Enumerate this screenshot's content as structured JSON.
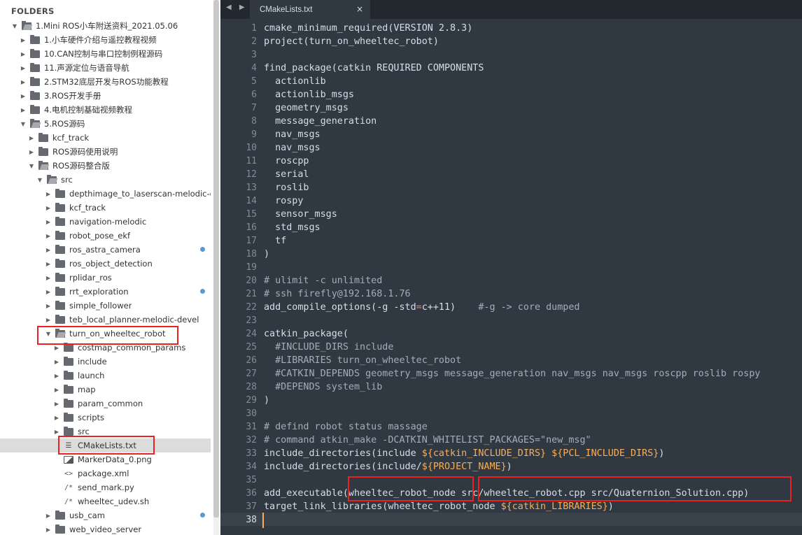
{
  "sidebar": {
    "title": "FOLDERS",
    "items": [
      {
        "label": "1.Mini ROS小车附送资料_2021.05.06",
        "depth": 0,
        "chevron": "▼",
        "icon": "folder-open-icon",
        "dot": false,
        "selected": false
      },
      {
        "label": "1.小车硬件介绍与遥控教程视频",
        "depth": 1,
        "chevron": "▶",
        "icon": "folder-icon",
        "dot": false,
        "selected": false
      },
      {
        "label": "10.CAN控制与串口控制例程源码",
        "depth": 1,
        "chevron": "▶",
        "icon": "folder-icon",
        "dot": false,
        "selected": false
      },
      {
        "label": "11.声源定位与语音导航",
        "depth": 1,
        "chevron": "▶",
        "icon": "folder-icon",
        "dot": false,
        "selected": false
      },
      {
        "label": "2.STM32底层开发与ROS功能教程",
        "depth": 1,
        "chevron": "▶",
        "icon": "folder-icon",
        "dot": false,
        "selected": false
      },
      {
        "label": "3.ROS开发手册",
        "depth": 1,
        "chevron": "▶",
        "icon": "folder-icon",
        "dot": false,
        "selected": false
      },
      {
        "label": "4.电机控制基础视频教程",
        "depth": 1,
        "chevron": "▶",
        "icon": "folder-icon",
        "dot": false,
        "selected": false
      },
      {
        "label": "5.ROS源码",
        "depth": 1,
        "chevron": "▼",
        "icon": "folder-open-icon",
        "dot": false,
        "selected": false
      },
      {
        "label": "kcf_track",
        "depth": 2,
        "chevron": "▶",
        "icon": "folder-icon",
        "dot": false,
        "selected": false
      },
      {
        "label": "ROS源码使用说明",
        "depth": 2,
        "chevron": "▶",
        "icon": "folder-icon",
        "dot": false,
        "selected": false
      },
      {
        "label": "ROS源码整合版",
        "depth": 2,
        "chevron": "▼",
        "icon": "folder-open-icon",
        "dot": false,
        "selected": false
      },
      {
        "label": "src",
        "depth": 3,
        "chevron": "▼",
        "icon": "folder-open-icon",
        "dot": false,
        "selected": false
      },
      {
        "label": "depthimage_to_laserscan-melodic-devel",
        "depth": 4,
        "chevron": "▶",
        "icon": "folder-icon",
        "dot": false,
        "selected": false
      },
      {
        "label": "kcf_track",
        "depth": 4,
        "chevron": "▶",
        "icon": "folder-icon",
        "dot": false,
        "selected": false
      },
      {
        "label": "navigation-melodic",
        "depth": 4,
        "chevron": "▶",
        "icon": "folder-icon",
        "dot": false,
        "selected": false
      },
      {
        "label": "robot_pose_ekf",
        "depth": 4,
        "chevron": "▶",
        "icon": "folder-icon",
        "dot": false,
        "selected": false
      },
      {
        "label": "ros_astra_camera",
        "depth": 4,
        "chevron": "▶",
        "icon": "folder-icon",
        "dot": true,
        "selected": false
      },
      {
        "label": "ros_object_detection",
        "depth": 4,
        "chevron": "▶",
        "icon": "folder-icon",
        "dot": false,
        "selected": false
      },
      {
        "label": "rplidar_ros",
        "depth": 4,
        "chevron": "▶",
        "icon": "folder-icon",
        "dot": false,
        "selected": false
      },
      {
        "label": "rrt_exploration",
        "depth": 4,
        "chevron": "▶",
        "icon": "folder-icon",
        "dot": true,
        "selected": false
      },
      {
        "label": "simple_follower",
        "depth": 4,
        "chevron": "▶",
        "icon": "folder-icon",
        "dot": false,
        "selected": false
      },
      {
        "label": "teb_local_planner-melodic-devel",
        "depth": 4,
        "chevron": "▶",
        "icon": "folder-icon",
        "dot": false,
        "selected": false
      },
      {
        "label": "turn_on_wheeltec_robot",
        "depth": 4,
        "chevron": "▼",
        "icon": "folder-open-icon",
        "dot": false,
        "selected": false
      },
      {
        "label": "costmap_common_params",
        "depth": 5,
        "chevron": "▶",
        "icon": "folder-icon",
        "dot": false,
        "selected": false
      },
      {
        "label": "include",
        "depth": 5,
        "chevron": "▶",
        "icon": "folder-icon",
        "dot": false,
        "selected": false
      },
      {
        "label": "launch",
        "depth": 5,
        "chevron": "▶",
        "icon": "folder-icon",
        "dot": false,
        "selected": false
      },
      {
        "label": "map",
        "depth": 5,
        "chevron": "▶",
        "icon": "folder-icon",
        "dot": false,
        "selected": false
      },
      {
        "label": "param_common",
        "depth": 5,
        "chevron": "▶",
        "icon": "folder-icon",
        "dot": false,
        "selected": false
      },
      {
        "label": "scripts",
        "depth": 5,
        "chevron": "▶",
        "icon": "folder-icon",
        "dot": false,
        "selected": false
      },
      {
        "label": "src",
        "depth": 5,
        "chevron": "▶",
        "icon": "folder-icon",
        "dot": false,
        "selected": false
      },
      {
        "label": "CMakeLists.txt",
        "depth": 5,
        "chevron": "",
        "icon": "text-file-icon",
        "dot": false,
        "selected": true
      },
      {
        "label": "MarkerData_0.png",
        "depth": 5,
        "chevron": "",
        "icon": "image-file-icon",
        "dot": false,
        "selected": false
      },
      {
        "label": "package.xml",
        "depth": 5,
        "chevron": "",
        "icon": "code-file-icon",
        "dot": false,
        "selected": false
      },
      {
        "label": "send_mark.py",
        "depth": 5,
        "chevron": "",
        "icon": "comment-file-icon",
        "dot": false,
        "selected": false
      },
      {
        "label": "wheeltec_udev.sh",
        "depth": 5,
        "chevron": "",
        "icon": "comment-file-icon",
        "dot": false,
        "selected": false
      },
      {
        "label": "usb_cam",
        "depth": 4,
        "chevron": "▶",
        "icon": "folder-icon",
        "dot": true,
        "selected": false
      },
      {
        "label": "web_video_server",
        "depth": 4,
        "chevron": "▶",
        "icon": "folder-icon",
        "dot": false,
        "selected": false
      }
    ]
  },
  "editor": {
    "nav_arrows": "◀ ▶",
    "tab": {
      "title": "CMakeLists.txt",
      "close": "×"
    },
    "active_line": 38,
    "lines": [
      [
        [
          "t",
          "cmake_minimum_required(VERSION 2.8.3)"
        ]
      ],
      [
        [
          "t",
          "project(turn_on_wheeltec_robot)"
        ]
      ],
      [],
      [
        [
          "t",
          "find_package(catkin REQUIRED COMPONENTS"
        ]
      ],
      [
        [
          "t",
          "  actionlib"
        ]
      ],
      [
        [
          "t",
          "  actionlib_msgs"
        ]
      ],
      [
        [
          "t",
          "  geometry_msgs"
        ]
      ],
      [
        [
          "t",
          "  message_generation"
        ]
      ],
      [
        [
          "t",
          "  nav_msgs"
        ]
      ],
      [
        [
          "t",
          "  nav_msgs"
        ]
      ],
      [
        [
          "t",
          "  roscpp"
        ]
      ],
      [
        [
          "t",
          "  serial"
        ]
      ],
      [
        [
          "t",
          "  roslib"
        ]
      ],
      [
        [
          "t",
          "  rospy"
        ]
      ],
      [
        [
          "t",
          "  sensor_msgs"
        ]
      ],
      [
        [
          "t",
          "  std_msgs"
        ]
      ],
      [
        [
          "t",
          "  tf"
        ]
      ],
      [
        [
          "t",
          ")"
        ]
      ],
      [],
      [
        [
          "c",
          "# ulimit -c unlimited"
        ]
      ],
      [
        [
          "c",
          "# ssh firefly@192.168.1.76"
        ]
      ],
      [
        [
          "t",
          "add_compile_options(-g -std"
        ],
        [
          "o",
          "="
        ],
        [
          "t",
          "c++11)    "
        ],
        [
          "c",
          "#-g -> core dumped"
        ]
      ],
      [],
      [
        [
          "t",
          "catkin_package("
        ]
      ],
      [
        [
          "c",
          "  #INCLUDE_DIRS include"
        ]
      ],
      [
        [
          "c",
          "  #LIBRARIES turn_on_wheeltec_robot"
        ]
      ],
      [
        [
          "c",
          "  #CATKIN_DEPENDS geometry_msgs message_generation nav_msgs nav_msgs roscpp roslib rospy"
        ]
      ],
      [
        [
          "c",
          "  #DEPENDS system_lib"
        ]
      ],
      [
        [
          "t",
          ")"
        ]
      ],
      [],
      [
        [
          "c",
          "# defind robot status massage"
        ]
      ],
      [
        [
          "c",
          "# command atkin_make -DCATKIN_WHITELIST_PACKAGES=\"new_msg\""
        ]
      ],
      [
        [
          "t",
          "include_directories(include "
        ],
        [
          "v",
          "${catkin_INCLUDE_DIRS}"
        ],
        [
          "t",
          " "
        ],
        [
          "v",
          "${PCL_INCLUDE_DIRS}"
        ],
        [
          "t",
          ")"
        ]
      ],
      [
        [
          "t",
          "include_directories(include/"
        ],
        [
          "v",
          "${PROJECT_NAME}"
        ],
        [
          "t",
          ")"
        ]
      ],
      [],
      [
        [
          "t",
          "add_executable(wheeltec_robot_node src/wheeltec_robot.cpp src/Quaternion_Solution.cpp)"
        ]
      ],
      [
        [
          "t",
          "target_link_libraries(wheeltec_robot_node "
        ],
        [
          "v",
          "${catkin_LIBRARIES}"
        ],
        [
          "t",
          ")"
        ]
      ],
      []
    ]
  }
}
